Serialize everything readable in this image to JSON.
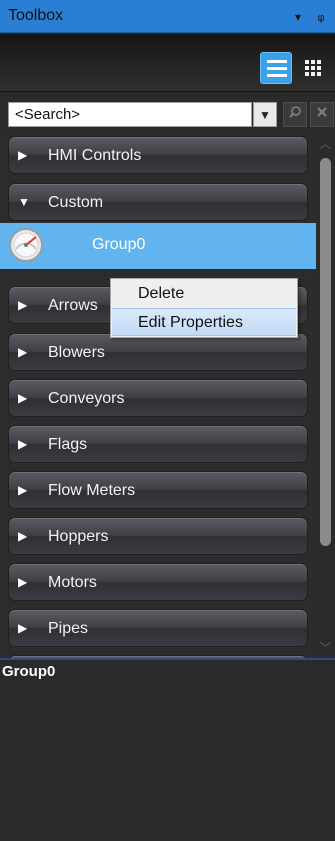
{
  "window": {
    "title": "Toolbox",
    "dropdown_glyph": "▾",
    "pin_glyph": "ᵩ"
  },
  "toolbar": {
    "list_view_icon": "list-view-icon",
    "grid_view_icon": "grid-view-icon",
    "list_view_selected": true
  },
  "search": {
    "value": "<Search>",
    "dropdown_glyph": "▼",
    "search_icon": "magnifier-icon",
    "clear_icon": "close-icon"
  },
  "categories": [
    {
      "label": "HMI Controls",
      "expanded": false
    },
    {
      "label": "Custom",
      "expanded": true
    },
    {
      "label": "Arrows",
      "expanded": false
    },
    {
      "label": "Blowers",
      "expanded": false
    },
    {
      "label": "Conveyors",
      "expanded": false
    },
    {
      "label": "Flags",
      "expanded": false
    },
    {
      "label": "Flow Meters",
      "expanded": false
    },
    {
      "label": "Hoppers",
      "expanded": false
    },
    {
      "label": "Motors",
      "expanded": false
    },
    {
      "label": "Pipes",
      "expanded": false
    }
  ],
  "selected_item": {
    "label": "Group0",
    "icon": "gauge-icon"
  },
  "context_menu": {
    "items": [
      "Delete",
      "Edit Properties"
    ]
  },
  "details": {
    "title": "Group0"
  },
  "colors": {
    "titlebar": "#2a7fd4",
    "selection": "#61b4ee",
    "active_button": "#39a1e5",
    "menu_highlight": "#c3daf5"
  }
}
